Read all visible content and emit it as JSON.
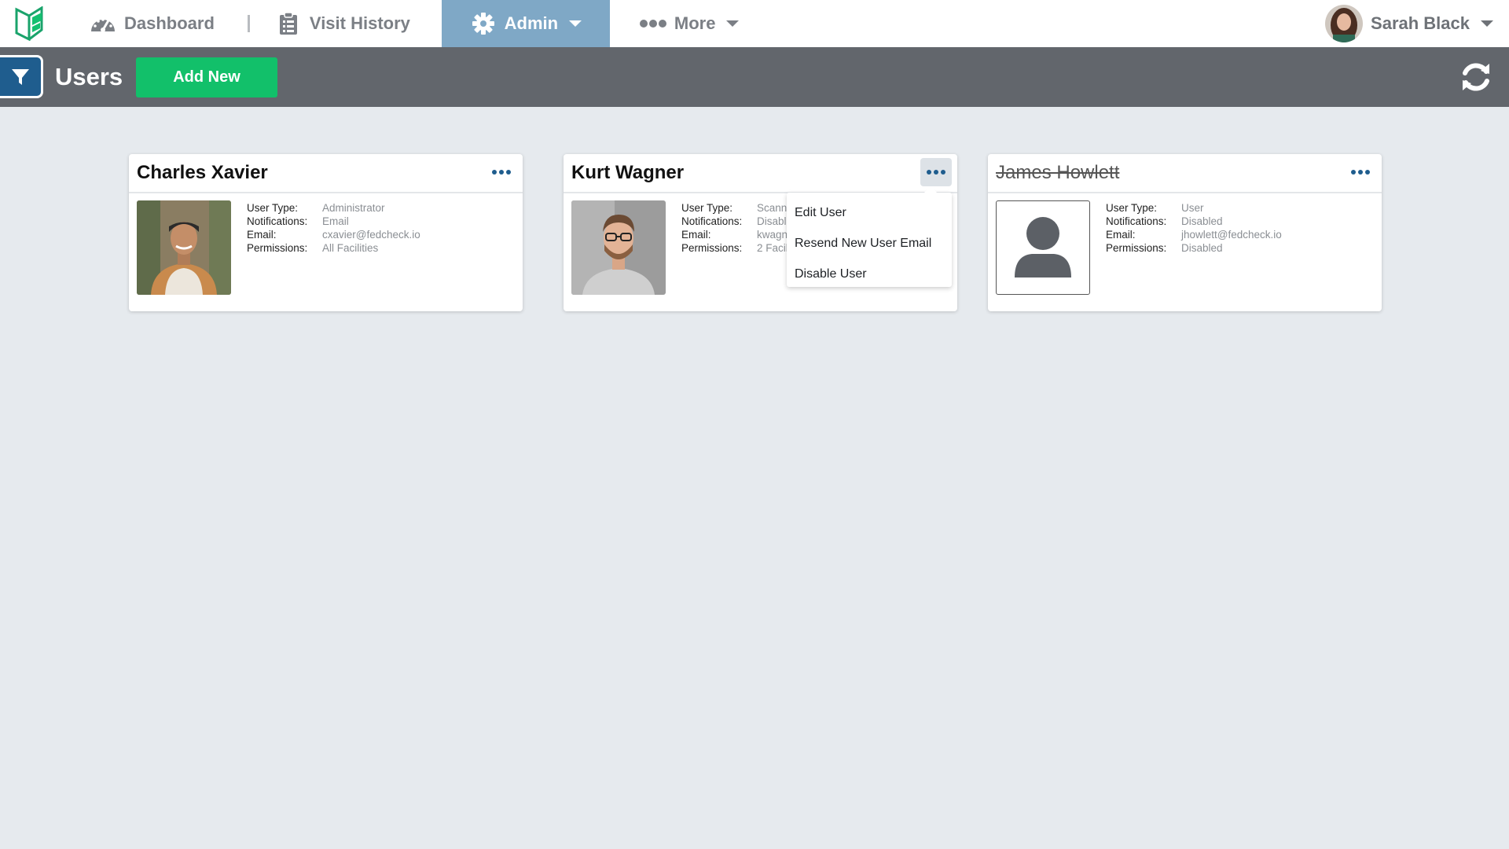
{
  "nav": {
    "items": [
      {
        "label": "Dashboard",
        "icon": "speedometer-icon"
      },
      {
        "label": "Visit History",
        "icon": "clipboard-icon"
      },
      {
        "label": "Admin",
        "icon": "gear-icon"
      },
      {
        "label": "More",
        "icon": "ellipsis-icon"
      }
    ],
    "user_name": "Sarah Black"
  },
  "subheader": {
    "title": "Users",
    "add_label": "Add New"
  },
  "colors": {
    "accent": "#1f5d8e",
    "admin_active": "#7fa8c6",
    "add_button": "#12c06a",
    "subheader": "#62666c"
  },
  "field_labels": {
    "user_type": "User Type:",
    "notifications": "Notifications:",
    "email": "Email:",
    "permissions": "Permissions:"
  },
  "users": [
    {
      "name": "Charles Xavier",
      "user_type": "Administrator",
      "notifications": "Email",
      "email": "cxavier@fedcheck.io",
      "permissions": "All Facilities"
    },
    {
      "name": "Kurt Wagner",
      "user_type": "Scann",
      "notifications": "Disabl",
      "email": "kwagn",
      "permissions": "2 Facil"
    },
    {
      "name": "James Howlett",
      "user_type": "User",
      "notifications": "Disabled",
      "email": "jhowlett@fedcheck.io",
      "permissions": "Disabled"
    }
  ],
  "dropdown": {
    "items": [
      "Edit User",
      "Resend New User Email",
      "Disable User"
    ]
  }
}
